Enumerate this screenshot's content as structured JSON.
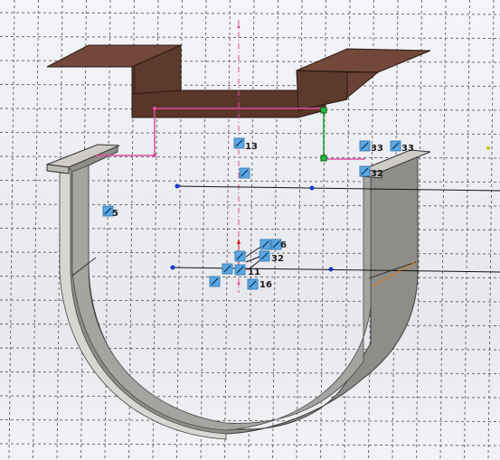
{
  "app": {
    "view": "sketch-3d-viewport"
  },
  "colors": {
    "grid": "#6b6b6b",
    "sheet_top": "#73483a",
    "sheet_front": "#5e3a2e",
    "sheet_side": "#4b2d23",
    "u_body": "#8f8d89",
    "u_edge": "#d8d6d2",
    "sketch_pink": "#e04c9c",
    "constraint_green": "#1f9a2f",
    "constraint_icon": "#5aa9e6",
    "blue_point": "#1838d0"
  },
  "relations": [
    {
      "id": "r13",
      "label": "13",
      "icon": "fix-icon"
    },
    {
      "id": "r33a",
      "label": "33",
      "icon": "parallel-icon"
    },
    {
      "id": "r33b",
      "label": "33",
      "icon": "parallel-icon"
    },
    {
      "id": "r32a",
      "label": "32",
      "icon": "horizontal-icon"
    },
    {
      "id": "r5",
      "label": "5",
      "icon": "vertical-icon"
    },
    {
      "id": "r6",
      "label": "6",
      "icon": "parallel-icon"
    },
    {
      "id": "r32b",
      "label": "32",
      "icon": "coincident-icon"
    },
    {
      "id": "r11",
      "label": "11",
      "icon": "fix-icon"
    },
    {
      "id": "r16",
      "label": "16",
      "icon": "vertical-icon"
    }
  ]
}
